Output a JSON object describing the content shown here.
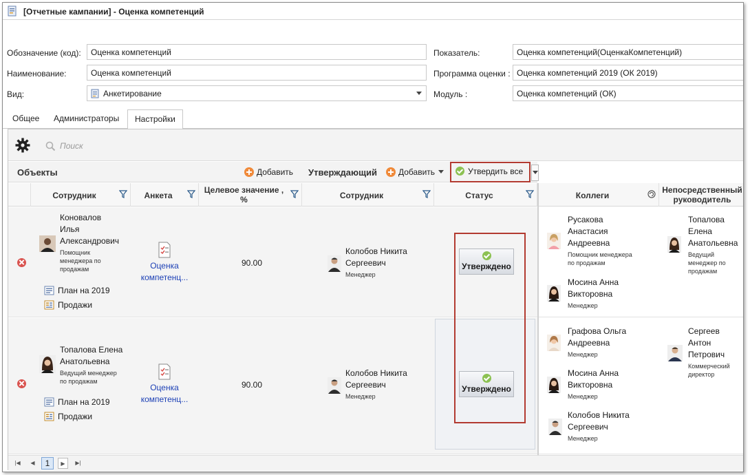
{
  "window": {
    "title": "[Отчетные кампании] - Оценка компетенций"
  },
  "form": {
    "code_label": "Обозначение (код):",
    "code_value": "Оценка компетенций",
    "name_label": "Наименование:",
    "name_value": "Оценка компетенций",
    "type_label": "Вид:",
    "type_value": "Анкетирование",
    "indicator_label": "Показатель:",
    "indicator_value": "Оценка компетенций(ОценкаКомпетенций)",
    "program_label": "Программа оценки :",
    "program_value": "Оценка компетенций 2019 (ОК 2019)",
    "module_label": "Модуль :",
    "module_value": "Оценка компетенций (ОК)"
  },
  "tabs": [
    {
      "label": "Общее"
    },
    {
      "label": "Администраторы"
    },
    {
      "label": "Настройки",
      "active": true
    }
  ],
  "toolbar": {
    "search_placeholder": "Поиск"
  },
  "objects_section": {
    "title": "Объекты",
    "add_label": "Добавить"
  },
  "approver_section": {
    "title": "Утверждающий",
    "add_label": "Добавить",
    "approve_all_label": "Утвердить все"
  },
  "columns": {
    "employee": "Сотрудник",
    "form": "Анкета",
    "target_line1": "Целевое значение ,",
    "target_line2": "%",
    "approver_employee": "Сотрудник",
    "status": "Статус",
    "colleagues": "Коллеги",
    "manager_line1": "Непосредственный",
    "manager_line2": "руководитель"
  },
  "rows": [
    {
      "employee": {
        "name_line1": "Коновалов",
        "name_line2": "Илья",
        "name_line3": "Александрович",
        "pos_line1": "Помощник",
        "pos_line2": "менеджера по",
        "pos_line3": "продажам"
      },
      "plan": "План на 2019",
      "sales": "Продажи",
      "form_line1": "Оценка",
      "form_line2": "компетенц...",
      "target": "90.00",
      "approver": {
        "name_line1": "Колобов Никита",
        "name_line2": "Сергеевич",
        "position": "Менеджер"
      },
      "status": "Утверждено",
      "colleagues": [
        {
          "name_line1": "Русакова",
          "name_line2": "Анастасия",
          "name_line3": "Андреевна",
          "pos_line1": "Помощник менеджера",
          "pos_line2": "по продажам"
        },
        {
          "name_line1": "Мосина Анна",
          "name_line2": "Викторовна",
          "pos_line1": "Менеджер"
        }
      ],
      "manager": {
        "name_line1": "Топалова",
        "name_line2": "Елена",
        "name_line3": "Анатольевна",
        "pos_line1": "Ведущий",
        "pos_line2": "менеджер по",
        "pos_line3": "продажам"
      }
    },
    {
      "employee": {
        "name_line1": "Топалова Елена",
        "name_line2": "Анатольевна",
        "pos_line1": "Ведущий менеджер",
        "pos_line2": "по продажам"
      },
      "plan": "План на 2019",
      "sales": "Продажи",
      "form_line1": "Оценка",
      "form_line2": "компетенц...",
      "target": "90.00",
      "approver": {
        "name_line1": "Колобов Никита",
        "name_line2": "Сергеевич",
        "position": "Менеджер"
      },
      "status": "Утверждено",
      "colleagues": [
        {
          "name_line1": "Графова Ольга",
          "name_line2": "Андреевна",
          "pos_line1": "Менеджер"
        },
        {
          "name_line1": "Мосина Анна",
          "name_line2": "Викторовна",
          "pos_line1": "Менеджер"
        },
        {
          "name_line1": "Колобов Никита",
          "name_line2": "Сергеевич",
          "pos_line1": "Менеджер"
        }
      ],
      "manager": {
        "name_line1": "Сергеев",
        "name_line2": "Антон",
        "name_line3": "Петрович",
        "pos_line1": "Коммерческий",
        "pos_line2": "директор"
      }
    }
  ],
  "pager": {
    "page": "1"
  },
  "colors": {
    "accent_red": "#b23a30",
    "link_blue": "#1b3fb5",
    "approved_green": "#8cc152",
    "add_orange": "#f08a3a"
  }
}
